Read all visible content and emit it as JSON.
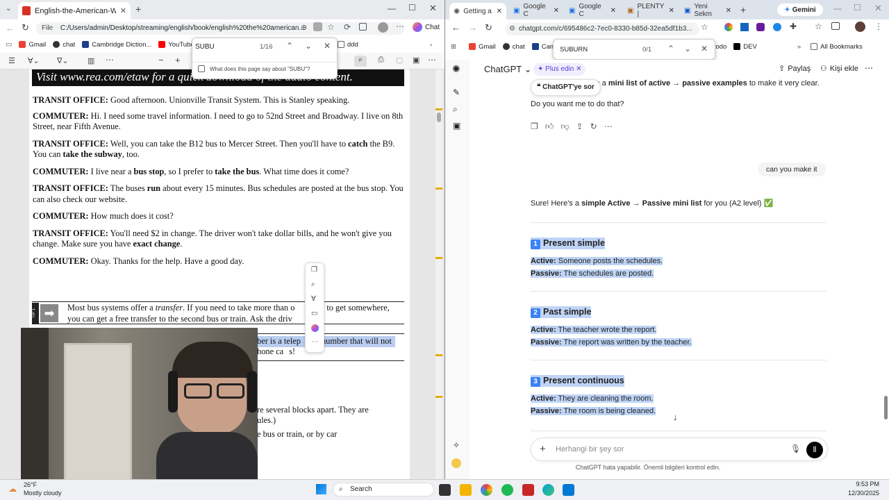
{
  "left": {
    "tab_title": "English-the-American-Way.pdf",
    "url_prefix": "File",
    "url": "C:/Users/admin/Desktop/streaming/english/book/english%20the%20american...",
    "chat_label": "Chat",
    "bookmarks": [
      "Gmail",
      "chat",
      "Cambridge Diction...",
      "YouTube",
      "sss",
      "ddd"
    ],
    "find": {
      "query": "SUBU",
      "count": "1/16",
      "suggest": "What does this page say about \"SUBU\"?"
    },
    "banner": "Visit www.rea.com/etaw for a quick download of the audio content.",
    "dialogue": [
      {
        "sp": "TRANSIT OFFICE:",
        "t": " Good afternoon. Unionville Transit System. This is Stanley speaking."
      },
      {
        "sp": "COMMUTER:",
        "t": " Hi. I need some travel information. I need to go to 52nd Street and Broadway. I live on 8th Street, near Fifth Avenue."
      },
      {
        "sp": "TRANSIT OFFICE:",
        "t1": " Well, you can take the B12 bus to Mercer Street. Then you'll have to ",
        "b1": "catch",
        "t2": " the B9. You can ",
        "b2": "take the subway",
        "t3": ", too."
      },
      {
        "sp": "COMMUTER:",
        "t1": " I live near a ",
        "b1": "bus stop",
        "t2": ", so I prefer to ",
        "b2": "take the bus",
        "t3": ". What time does it come?"
      },
      {
        "sp": "TRANSIT OFFICE:",
        "t1": " The buses ",
        "b1": "run",
        "t2": " about every 15 minutes. Bus schedules are posted at the bus stop. You can also check our website."
      },
      {
        "sp": "COMMUTER:",
        "t": " How much does it cost?"
      },
      {
        "sp": "TRANSIT OFFICE:",
        "t1": " You'll need $2 in change. The driver won't take dollar bills, and he won't give you change. Make sure you have ",
        "b1": "exact change",
        "t2": "."
      },
      {
        "sp": "COMMUTER:",
        "t": " Okay. Thanks for the help. Have a good day."
      }
    ],
    "tip_label": "TIP 1",
    "tip1a": "Most bus systems offer a ",
    "tip1i": "transfer",
    "tip1b": ". If you need to take more than o",
    "tip1c": "s to get somewhere,",
    "tip2": "you can get a free transfer to the second bus or train. Ask the driv",
    "line3a": "ber is a telep",
    "line3b": "number that will not",
    "line4": "hone ca",
    "line4b": "s!",
    "line5": "re several blocks apart. They are",
    "line6": "ules.)",
    "line7": "e bus or train, or by car"
  },
  "right": {
    "tabs": [
      "Getting a",
      "Google C",
      "Google C",
      "PLENTY |",
      "Yeni Sekm"
    ],
    "gemini": "Gemini",
    "url": "chatgpt.com/c/695486c2-7ec0-8330-b85d-32ea5df1b3...",
    "bookmarks": [
      "Gmail",
      "chat",
      "Cam",
      "todo",
      "DEV"
    ],
    "all_bookmarks": "All Bookmarks",
    "find": {
      "query": "SUBURN",
      "count": "0/1"
    },
    "brand": "ChatGPT",
    "plus": "Plus edin",
    "share": "Paylaş",
    "add_person": "Kişi ekle",
    "ask_chip": "ChatGPT'ye sor",
    "prev_text_a": "ke a ",
    "prev_text_b": "mini list of active → passive examples",
    "prev_text_c": " to make it very clear.",
    "question": "Do you want me to do that?",
    "user_msg": "can you make it",
    "intro_a": "Sure! Here's a ",
    "intro_b": "simple Active → Passive mini list",
    "intro_c": " for you (A2 level) ✅",
    "sections": [
      {
        "num": "1",
        "title": "Present simple",
        "active": "Someone posts the schedules.",
        "passive": "The schedules are posted."
      },
      {
        "num": "2",
        "title": "Past simple",
        "active": "The teacher wrote the report.",
        "passive": "The report was written by the teacher."
      },
      {
        "num": "3",
        "title": "Present continuous",
        "active": "They are cleaning the room.",
        "passive": "The room is being cleaned."
      }
    ],
    "active_label": "Active:",
    "passive_label": "Passive:",
    "input_placeholder": "Herhangi bir şey sor",
    "disclaimer": "ChatGPT hata yapabilir. Önemli bilgileri kontrol edin."
  },
  "taskbar": {
    "temp": "26°F",
    "weather": "Mostly cloudy",
    "search": "Search",
    "time": "9:53 PM",
    "date": "12/30/2025"
  }
}
